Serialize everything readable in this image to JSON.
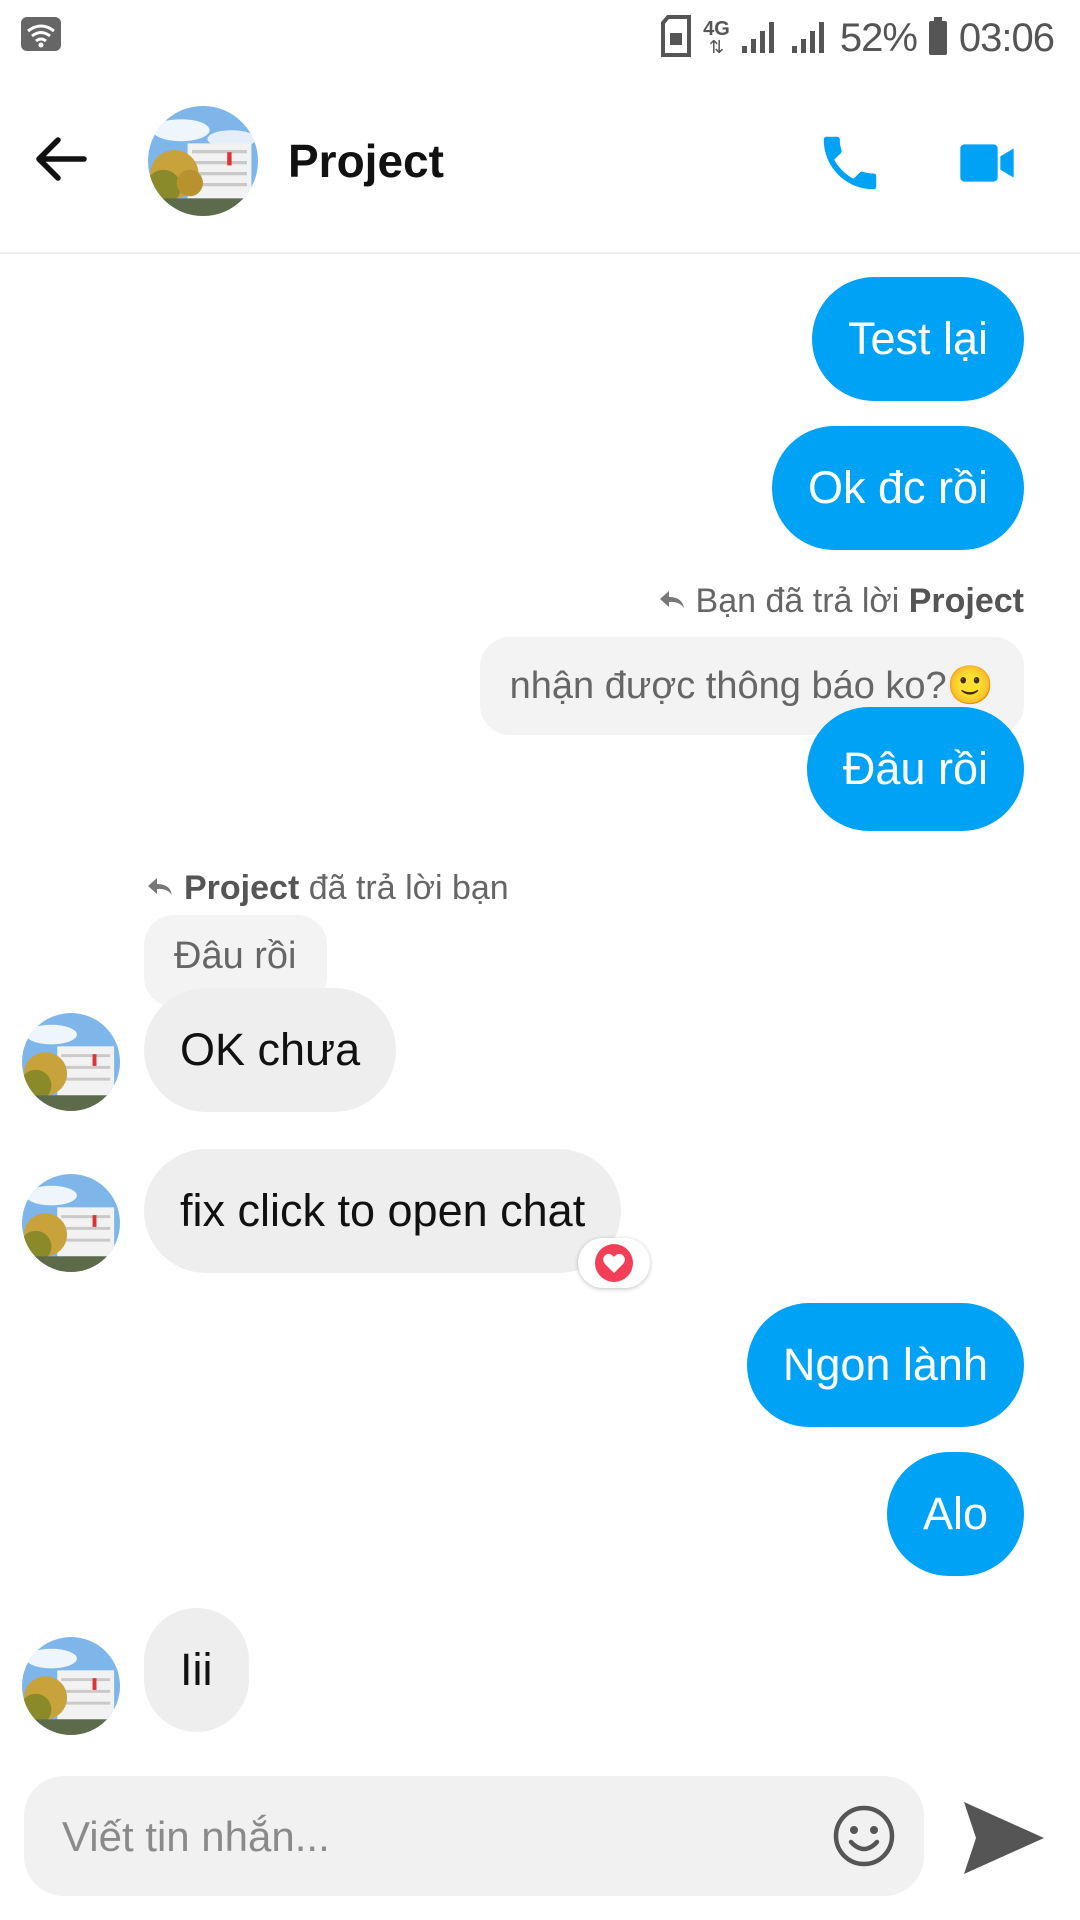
{
  "status_bar": {
    "battery": "52%",
    "time": "03:06",
    "network": "4G"
  },
  "header": {
    "title": "Project"
  },
  "colors": {
    "accent": "#00a2f6",
    "incoming_bubble": "#eeeeee"
  },
  "messages": {
    "m1": "Test lại",
    "m2": "Ok đc rồi",
    "reply1": {
      "prefix": "Bạn đã trả lời ",
      "name": "Project",
      "quote": "nhận được thông báo ko?🙂"
    },
    "m3": "Đâu rồi",
    "reply2": {
      "name": "Project",
      "suffix": " đã trả lời bạn",
      "quote": "Đâu rồi"
    },
    "m4": "OK chưa",
    "m5": "fix click to open chat",
    "m6": "Ngon lành",
    "m7": "Alo",
    "m8": "Iii"
  },
  "composer": {
    "placeholder": "Viết tin nhắn..."
  },
  "icons": {
    "back": "arrow-left-icon",
    "call": "phone-icon",
    "video": "video-camera-icon",
    "emoji": "smiley-icon",
    "send": "send-icon",
    "reaction": "heart-icon"
  }
}
